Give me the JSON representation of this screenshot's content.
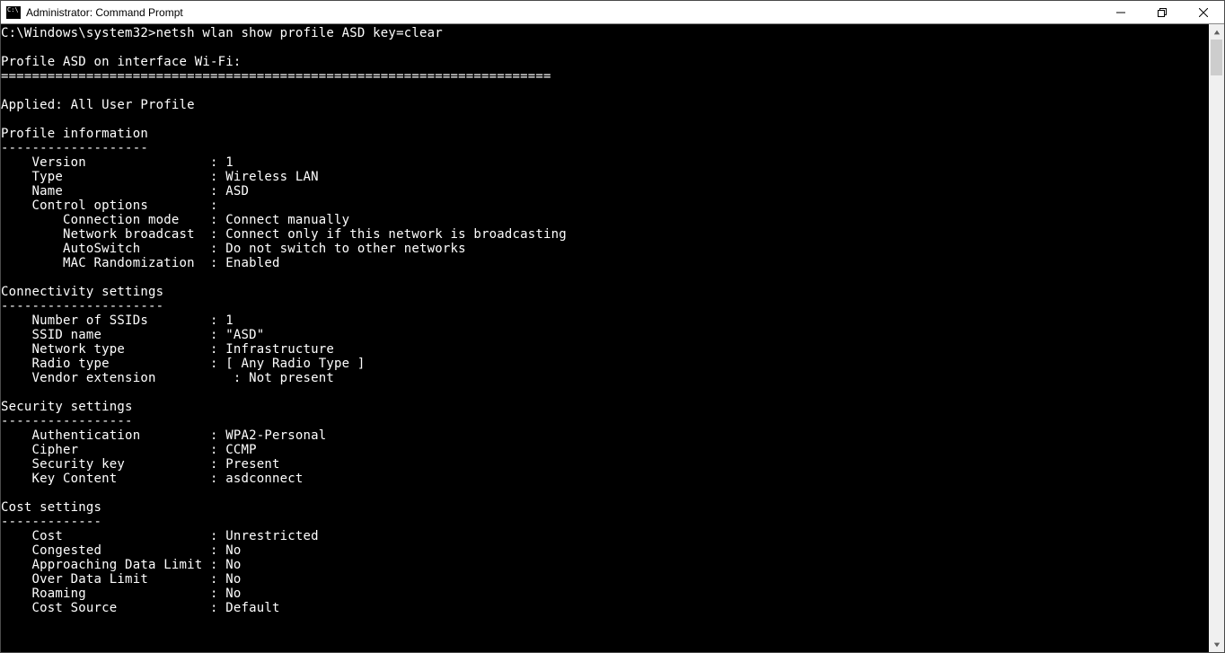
{
  "window": {
    "title": "Administrator: Command Prompt"
  },
  "prompt": {
    "path": "C:\\Windows\\system32>",
    "command": "netsh wlan show profile ASD key=clear"
  },
  "profile_header": "Profile ASD on interface Wi-Fi:",
  "separator": "=======================================================================",
  "applied": "Applied: All User Profile",
  "sections": {
    "profile_info": {
      "title": "Profile information",
      "underline": "-------------------",
      "rows": [
        {
          "l": "    Version                : ",
          "v": "1"
        },
        {
          "l": "    Type                   : ",
          "v": "Wireless LAN"
        },
        {
          "l": "    Name                   : ",
          "v": "ASD"
        },
        {
          "l": "    Control options        :",
          "v": ""
        },
        {
          "l": "        Connection mode    : ",
          "v": "Connect manually"
        },
        {
          "l": "        Network broadcast  : ",
          "v": "Connect only if this network is broadcasting"
        },
        {
          "l": "        AutoSwitch         : ",
          "v": "Do not switch to other networks"
        },
        {
          "l": "        MAC Randomization  : ",
          "v": "Enabled"
        }
      ]
    },
    "connectivity": {
      "title": "Connectivity settings",
      "underline": "---------------------",
      "rows": [
        {
          "l": "    Number of SSIDs        : ",
          "v": "1"
        },
        {
          "l": "    SSID name              : ",
          "v": "\"ASD\""
        },
        {
          "l": "    Network type           : ",
          "v": "Infrastructure"
        },
        {
          "l": "    Radio type             : ",
          "v": "[ Any Radio Type ]"
        },
        {
          "l": "    Vendor extension          : ",
          "v": "Not present"
        }
      ]
    },
    "security": {
      "title": "Security settings",
      "underline": "-----------------",
      "rows": [
        {
          "l": "    Authentication         : ",
          "v": "WPA2-Personal"
        },
        {
          "l": "    Cipher                 : ",
          "v": "CCMP"
        },
        {
          "l": "    Security key           : ",
          "v": "Present"
        },
        {
          "l": "    Key Content            : ",
          "v": "asdconnect"
        }
      ]
    },
    "cost": {
      "title": "Cost settings",
      "underline": "-------------",
      "rows": [
        {
          "l": "    Cost                   : ",
          "v": "Unrestricted"
        },
        {
          "l": "    Congested              : ",
          "v": "No"
        },
        {
          "l": "    Approaching Data Limit : ",
          "v": "No"
        },
        {
          "l": "    Over Data Limit        : ",
          "v": "No"
        },
        {
          "l": "    Roaming                : ",
          "v": "No"
        },
        {
          "l": "    Cost Source            : ",
          "v": "Default"
        }
      ]
    }
  }
}
